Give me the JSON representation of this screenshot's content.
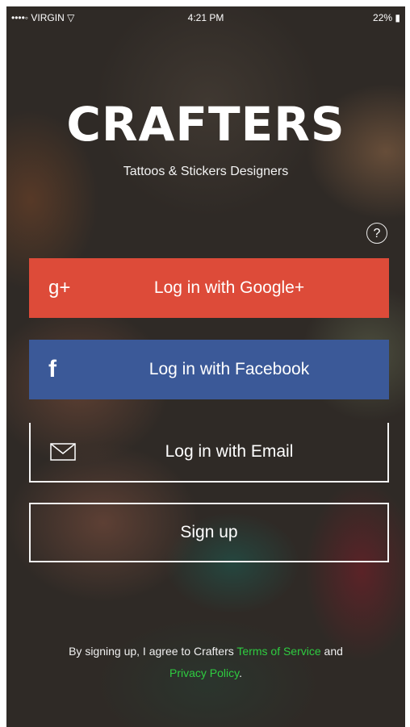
{
  "status_bar": {
    "carrier": "••••◦ VIRGIN ▽",
    "time": "4:21 PM",
    "battery": "22% ▮"
  },
  "app": {
    "logo_text": "CRAFTERS",
    "tagline": "Tattoos & Stickers Designers"
  },
  "help_icon": "question-circle-icon",
  "buttons": {
    "google": {
      "icon_text": "g+",
      "label": "Log in with Google+",
      "color": "#dd4b39"
    },
    "facebook": {
      "icon_text": "f",
      "label": "Log in with Facebook",
      "color": "#3b5998"
    },
    "email": {
      "icon": "envelope-icon",
      "label": "Log in with Email"
    },
    "signup": {
      "label": "Sign up"
    }
  },
  "legal": {
    "prefix": "By signing up, I agree to Crafters ",
    "terms_link": "Terms of Service",
    "middle": " and ",
    "privacy_link": "Privacy Policy",
    "suffix": ".",
    "link_color": "#2ecc40"
  }
}
